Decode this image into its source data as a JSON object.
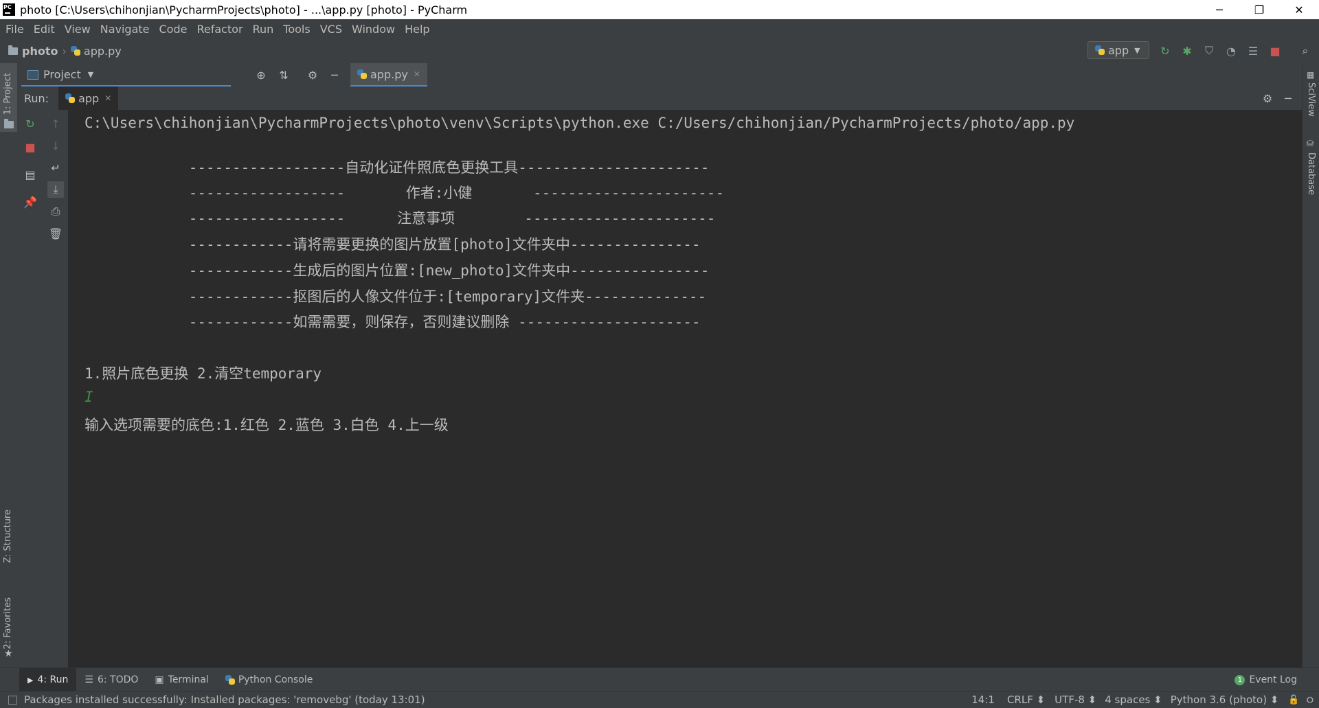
{
  "window": {
    "title": "photo [C:\\Users\\chihonjian\\PycharmProjects\\photo] - ...\\app.py [photo] - PyCharm",
    "minimize": "─",
    "restore": "❐",
    "close": "✕"
  },
  "menu": [
    "File",
    "Edit",
    "View",
    "Navigate",
    "Code",
    "Refactor",
    "Run",
    "Tools",
    "VCS",
    "Window",
    "Help"
  ],
  "nav": {
    "project": "photo",
    "file": "app.py",
    "run_config": "app"
  },
  "project_panel": {
    "label": "Project",
    "editor_tab": "app.py"
  },
  "run_panel": {
    "label": "Run:",
    "tab": "app"
  },
  "side_tabs": {
    "project": "1: Project",
    "structure": "Z: Structure",
    "favorites": "2: Favorites",
    "sciview": "SciView",
    "database": "Database"
  },
  "console": {
    "lines": [
      "C:\\Users\\chihonjian\\PycharmProjects\\photo\\venv\\Scripts\\python.exe C:/Users/chihonjian/PycharmProjects/photo/app.py",
      "",
      "            ------------------自动化证件照底色更换工具----------------------",
      "            ------------------       作者:小健       ----------------------",
      "            ------------------      注意事项        ----------------------",
      "            ------------请将需要更换的图片放置[photo]文件夹中---------------",
      "            ------------生成后的图片位置:[new_photo]文件夹中----------------",
      "            ------------抠图后的人像文件位于:[temporary]文件夹--------------",
      "            ------------如需需要，则保存，否则建议删除 ---------------------",
      "",
      "1.照片底色更换 2.清空temporary",
      "I",
      "输入选项需要的底色:1.红色 2.蓝色 3.白色 4.上一级"
    ]
  },
  "bottom_tabs": {
    "run": "4: Run",
    "todo": "6: TODO",
    "terminal": "Terminal",
    "python_console": "Python Console",
    "event_log": "Event Log",
    "event_count": "1"
  },
  "status": {
    "message": "Packages installed successfully: Installed packages: 'removebg' (today 13:01)",
    "position": "14:1",
    "line_sep": "CRLF ⬍",
    "encoding": "UTF-8 ⬍",
    "indent": "4 spaces ⬍",
    "interpreter": "Python 3.6 (photo) ⬍"
  },
  "colors": {
    "accent_green": "#59a869",
    "stop_red": "#c75450",
    "caret_green": "#3e8e41"
  }
}
